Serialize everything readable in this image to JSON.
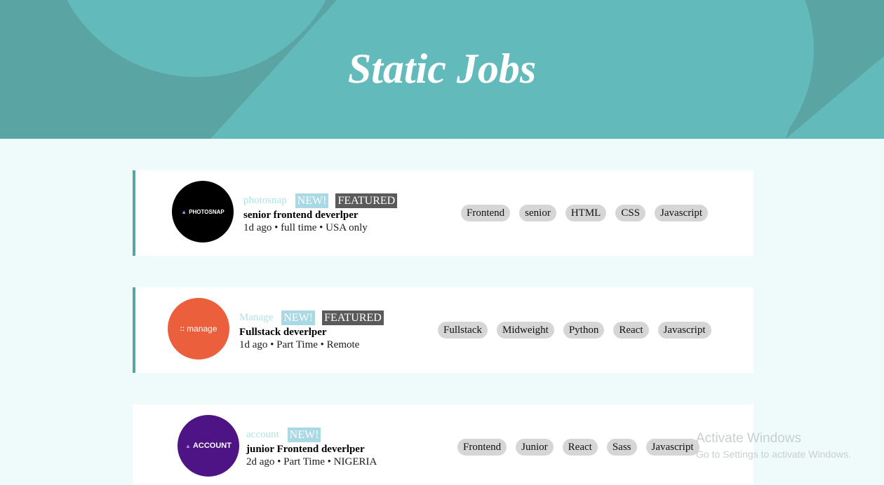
{
  "header": {
    "title": "Static Jobs"
  },
  "jobs": [
    {
      "company": "photosnap",
      "logo_text": "PHOTOSNAP",
      "logo_color": "#000000",
      "new_label": "NEW!",
      "featured_label": "FEATURED",
      "position": "senior frontend deverlper",
      "meta": "1d ago • full time • USA only",
      "tags": [
        "Frontend",
        "senior",
        "HTML",
        "CSS",
        "Javascript"
      ]
    },
    {
      "company": "Manage",
      "logo_text": "manage",
      "logo_color": "#eb5f3d",
      "new_label": "NEW!",
      "featured_label": "FEATURED",
      "position": "Fullstack deverlper",
      "meta": "1d ago • Part Time • Remote",
      "tags": [
        "Fullstack",
        "Midweight",
        "Python",
        "React",
        "Javascript"
      ]
    },
    {
      "company": "account",
      "logo_text": "ACCOUNT",
      "logo_color": "#4e1485",
      "new_label": "NEW!",
      "position": "junior Frontend deverlper",
      "meta": "2d ago • Part Time • NIGERIA",
      "tags": [
        "Frontend",
        "Junior",
        "React",
        "Sass",
        "Javascript"
      ]
    }
  ],
  "watermark": {
    "line1": "Activate Windows",
    "line2": "Go to Settings to activate Windows."
  },
  "colors": {
    "header_bg": "#5ba4a4",
    "page_bg": "#effafa",
    "accent": "#5ba4a4"
  }
}
